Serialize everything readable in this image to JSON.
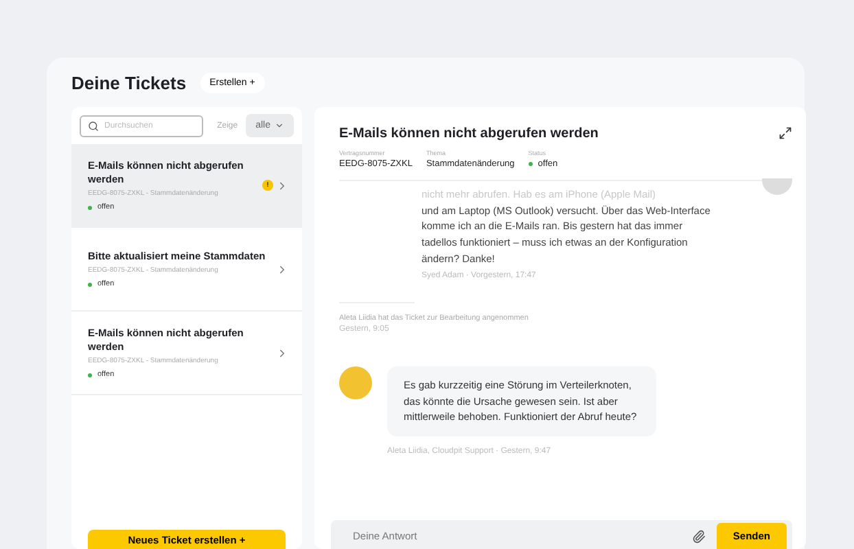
{
  "header": {
    "title": "Deine Tickets",
    "create_button": "Erstellen +"
  },
  "list": {
    "search": {
      "placeholder": "Durchsuchen"
    },
    "filter_label": "Zeige",
    "filter": {
      "value": "alle"
    },
    "tickets": [
      {
        "title": "E-Mails können nicht abgerufen werden",
        "meta": "EEDG-8075-ZXKL - Stammdatenänderung",
        "status": "offen",
        "selected": true,
        "alert": true,
        "alert_text": "!"
      },
      {
        "title": "Bitte aktualisiert meine Stammdaten",
        "meta": "EEDG-8075-ZXKL - Stammdatenänderung",
        "status": "offen",
        "selected": false,
        "alert": false
      },
      {
        "title": "E-Mails können nicht abgerufen werden",
        "meta": "EEDG-8075-ZXKL - Stammdatenänderung",
        "status": "offen",
        "selected": false,
        "alert": false
      }
    ],
    "new_button": "Neues Ticket erstellen +"
  },
  "detail": {
    "title": "E-Mails können nicht abgerufen werden",
    "fields": [
      {
        "label": "Vertragsnummer",
        "value": "EEDG-8075-ZXKL",
        "kind": "text"
      },
      {
        "label": "Thema",
        "value": "Stammdatenänderung",
        "kind": "text"
      },
      {
        "label": "Status",
        "value": "offen",
        "kind": "status"
      }
    ],
    "messages": [
      {
        "kind": "customer",
        "faded_line": "nicht mehr abrufen. Hab es am iPhone (Apple Mail)",
        "text": "und am Laptop (MS Outlook) versucht. Über das Web-Interface komme ich an die E-Mails ran. Bis gestern hat das immer tadellos funktioniert – muss ich etwas an der Konfiguration ändern? Danke!",
        "meta": "Syed Adam · Vorgestern, 17:47"
      },
      {
        "kind": "event",
        "text": "Aleta Liidia hat das Ticket zur Bearbeitung angenommen",
        "meta": "Gestern, 9:05"
      },
      {
        "kind": "support",
        "text": "Es gab kurzzeitig eine Störung im Verteilerknoten, das könnte die Ursache gewesen sein. Ist aber mittlerweile behoben. Funktioniert der Abruf heute?",
        "meta": "Aleta Liidia, Cloudpit Support · Gestern, 9:47"
      }
    ],
    "reply": {
      "placeholder": "Deine Antwort",
      "send_button": "Senden"
    }
  }
}
